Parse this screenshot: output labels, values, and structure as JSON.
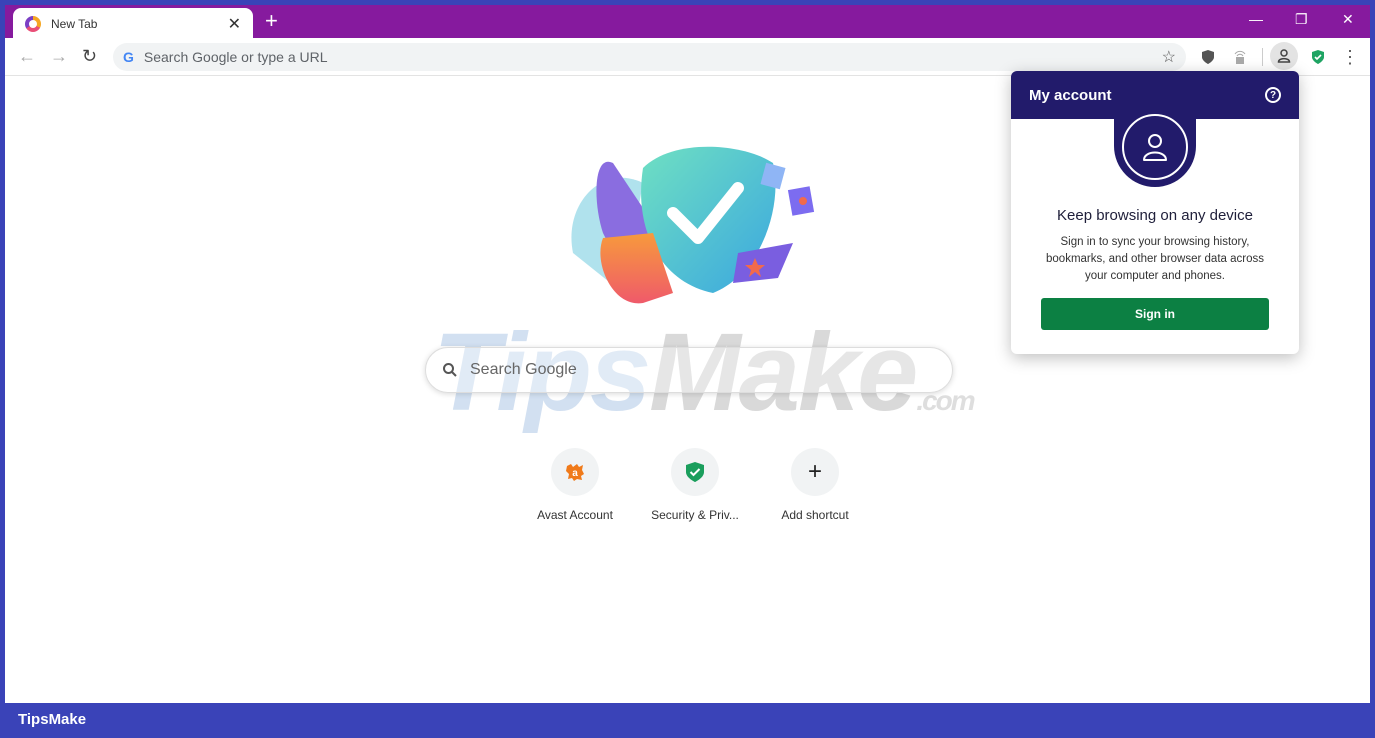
{
  "browser": {
    "tab": {
      "title": "New Tab",
      "close": "✕"
    },
    "new_tab": "+",
    "window_controls": {
      "minimize": "—",
      "restore": "❐",
      "close": "✕"
    },
    "nav": {
      "back": "←",
      "forward": "→",
      "reload": "↻"
    },
    "omnibox": {
      "google_glyph": "G",
      "placeholder": "Search Google or type a URL"
    },
    "bookmark_star": "☆",
    "menu": "⋮"
  },
  "ntp": {
    "watermark": {
      "tips": "Tips",
      "make": "Make",
      "com": ".com"
    },
    "search": {
      "icon": "🔍",
      "placeholder": "Search Google"
    },
    "shortcuts": [
      {
        "label": "Avast Account",
        "icon": "avast-icon"
      },
      {
        "label": "Security & Priv...",
        "icon": "shield-check-icon"
      },
      {
        "label": "Add shortcut",
        "icon": "plus-icon",
        "glyph": "+"
      }
    ]
  },
  "account_popup": {
    "title": "My account",
    "help": "?",
    "heading": "Keep browsing on any device",
    "description": "Sign in to sync your browsing history, bookmarks, and other browser data across your computer and phones.",
    "sign_in_label": "Sign in",
    "colors": {
      "header": "#221b6b",
      "button": "#0c8043"
    }
  },
  "footer": {
    "brand": "TipsMake"
  },
  "colors": {
    "titlebar": "#861a9e",
    "frame": "#3a43b8"
  }
}
